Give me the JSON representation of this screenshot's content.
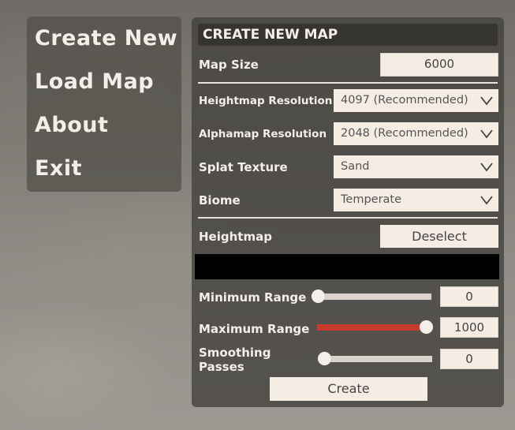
{
  "menu": {
    "items": [
      "Create New",
      "Load Map",
      "About",
      "Exit"
    ]
  },
  "panel": {
    "title": "CREATE NEW MAP",
    "map_size": {
      "label": "Map Size",
      "value": "6000"
    },
    "heightmap_resolution": {
      "label": "Heightmap Resolution",
      "value": "4097 (Recommended)"
    },
    "alphamap_resolution": {
      "label": "Alphamap Resolution",
      "value": "2048 (Recommended)"
    },
    "splat_texture": {
      "label": "Splat Texture",
      "value": "Sand"
    },
    "biome": {
      "label": "Biome",
      "value": "Temperate"
    },
    "heightmap": {
      "label": "Heightmap",
      "button": "Deselect"
    },
    "minimum_range": {
      "label": "Minimum Range",
      "value": "0",
      "fraction": 0.0
    },
    "maximum_range": {
      "label": "Maximum Range",
      "value": "1000",
      "fraction": 1.0
    },
    "smoothing_passes": {
      "label_line1": "Smoothing",
      "label_line2": "Passes",
      "value": "0",
      "fraction": 0.0
    },
    "create_button": "Create"
  },
  "colors": {
    "slider_fill": "#c83a2a",
    "field_bg": "#f5ece4",
    "text": "#f3eee7"
  }
}
